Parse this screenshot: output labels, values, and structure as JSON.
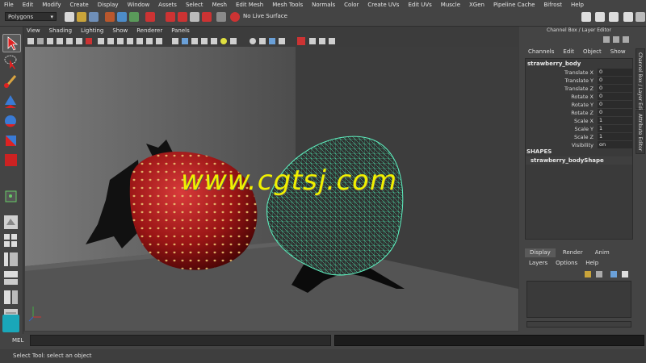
{
  "menubar": {
    "items": [
      "File",
      "Edit",
      "Modify",
      "Create",
      "Display",
      "Window",
      "Assets",
      "Select",
      "Mesh",
      "Edit Mesh",
      "Mesh Tools",
      "Normals",
      "Color",
      "Create UVs",
      "Edit UVs",
      "Muscle",
      "XGen",
      "Pipeline Cache",
      "Bifrost",
      "Help"
    ]
  },
  "statusline": {
    "mode": "Polygons",
    "live_surface": "No Live Surface"
  },
  "viewport": {
    "menu": [
      "View",
      "Shading",
      "Lighting",
      "Show",
      "Renderer",
      "Panels"
    ],
    "watermark": "www.cgtsj.com"
  },
  "channel_box": {
    "title": "Channel Box / Layer Editor",
    "menu": [
      "Channels",
      "Edit",
      "Object",
      "Show"
    ],
    "object_name": "strawberry_body",
    "attributes": [
      {
        "label": "Translate X",
        "value": "0"
      },
      {
        "label": "Translate Y",
        "value": "0"
      },
      {
        "label": "Translate Z",
        "value": "0"
      },
      {
        "label": "Rotate X",
        "value": "0"
      },
      {
        "label": "Rotate Y",
        "value": "0"
      },
      {
        "label": "Rotate Z",
        "value": "0"
      },
      {
        "label": "Scale X",
        "value": "1"
      },
      {
        "label": "Scale Y",
        "value": "1"
      },
      {
        "label": "Scale Z",
        "value": "1"
      },
      {
        "label": "Visibility",
        "value": "on"
      }
    ],
    "shapes_heading": "SHAPES",
    "shape_name": "strawberry_bodyShape"
  },
  "side_tabs": [
    "Channel Box / Layer Editor",
    "Attribute Editor"
  ],
  "layer_editor": {
    "tabs": [
      "Display",
      "Render",
      "Anim"
    ],
    "active_tab": "Display",
    "menu": [
      "Layers",
      "Options",
      "Help"
    ]
  },
  "command_line": {
    "label": "MEL"
  },
  "help_line": {
    "text": "Select Tool: select an object"
  }
}
